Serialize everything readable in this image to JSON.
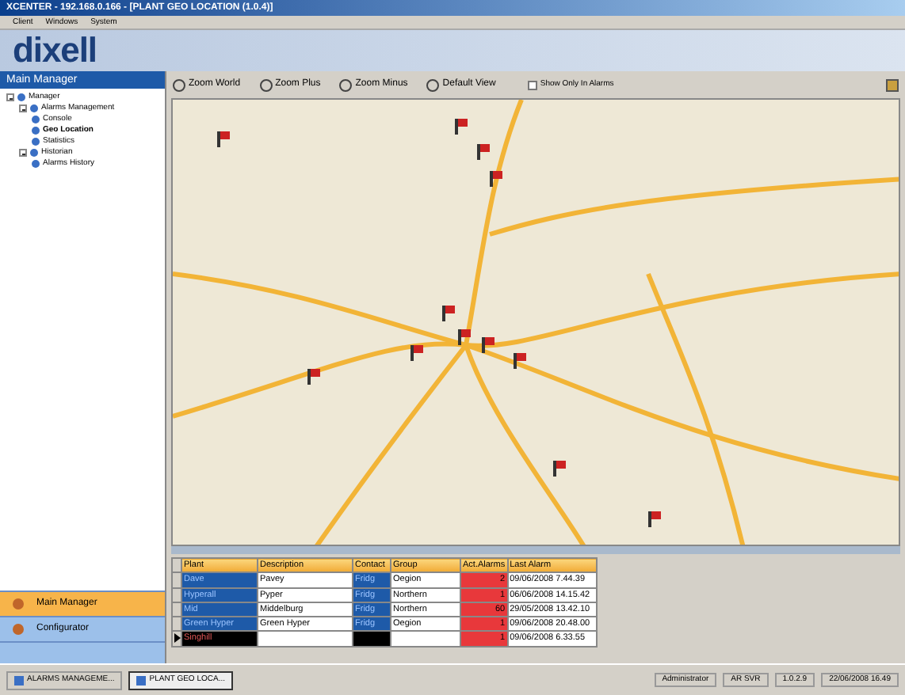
{
  "window": {
    "title": "XCENTER - 192.168.0.166 - [PLANT GEO LOCATION (1.0.4)]"
  },
  "menu": [
    "Client",
    "Windows",
    "System"
  ],
  "logo": "dixell",
  "sidebar": {
    "title": "Main Manager",
    "tree": [
      {
        "label": "Manager",
        "expanded": true,
        "children": [
          {
            "label": "Alarms Management",
            "expanded": true,
            "children": [
              {
                "label": "Console",
                "selected": false
              },
              {
                "label": "Geo Location",
                "selected": true
              },
              {
                "label": "Statistics",
                "selected": false
              }
            ]
          },
          {
            "label": "Historian",
            "expanded": true,
            "children": [
              {
                "label": "Alarms History",
                "selected": false
              }
            ]
          }
        ]
      }
    ],
    "nav": [
      {
        "label": "Main Manager",
        "selected": true
      },
      {
        "label": "Configurator",
        "selected": false
      }
    ]
  },
  "toolbar": {
    "buttons": [
      "Zoom World",
      "Zoom Plus",
      "Zoom Minus",
      "Default View"
    ],
    "show_only_in_alarms": {
      "label": "Show Only In Alarms",
      "checked": false
    }
  },
  "table": {
    "columns": [
      "Plant",
      "Description",
      "Contact",
      "Group",
      "Act.Alarms",
      "Last Alarm"
    ],
    "rows": [
      {
        "selected": false,
        "cells": [
          "Dave",
          "Pavey",
          "Fridg",
          "Oegion",
          "2",
          "09/06/2008 7.44.39"
        ]
      },
      {
        "selected": false,
        "cells": [
          "Hyperall",
          "Pyper",
          "Fridg",
          "Northern",
          "1",
          "06/06/2008 14.15.42"
        ]
      },
      {
        "selected": false,
        "cells": [
          "Mid",
          "Middelburg",
          "Fridg",
          "Northern",
          "60",
          "29/05/2008 13.42.10"
        ]
      },
      {
        "selected": false,
        "cells": [
          "Green Hyper",
          "Green Hyper",
          "Fridg",
          "Oegion",
          "1",
          "09/06/2008 20.48.00"
        ]
      },
      {
        "selected": true,
        "cells": [
          "Singhill",
          "",
          "",
          "",
          "1",
          "09/06/2008 6.33.55"
        ]
      }
    ]
  },
  "taskbar": [
    {
      "label": "ALARMS MANAGEME...",
      "selected": false
    },
    {
      "label": "PLANT GEO LOCA...",
      "selected": true
    }
  ],
  "status_bar": [
    "Administrator",
    "AR SVR",
    "1.0.2.9",
    "22/06/2008 16.49"
  ]
}
